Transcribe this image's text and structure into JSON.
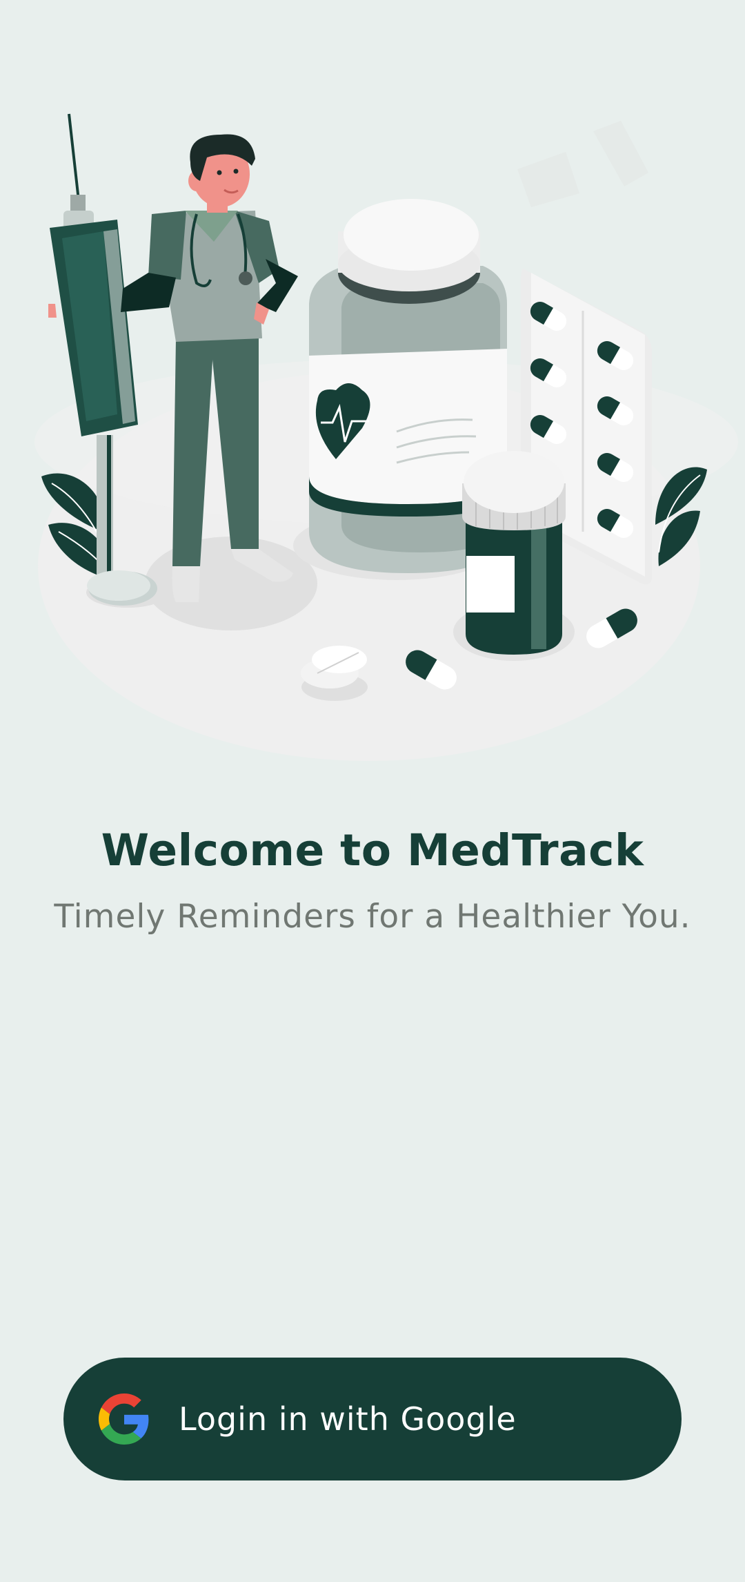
{
  "app": {
    "name": "MedTrack"
  },
  "hero": {
    "illustration": "doctor-with-syringe-and-medicine-bottles-illustration"
  },
  "welcome": {
    "title": "Welcome to MedTrack",
    "subtitle": "Timely Reminders for a Healthier You."
  },
  "login_button": {
    "label": "Login in with Google",
    "icon": "google-icon"
  },
  "colors": {
    "background": "#e8efed",
    "primary": "#163f37",
    "subtitle": "#707772",
    "button_text": "#ffffff"
  }
}
